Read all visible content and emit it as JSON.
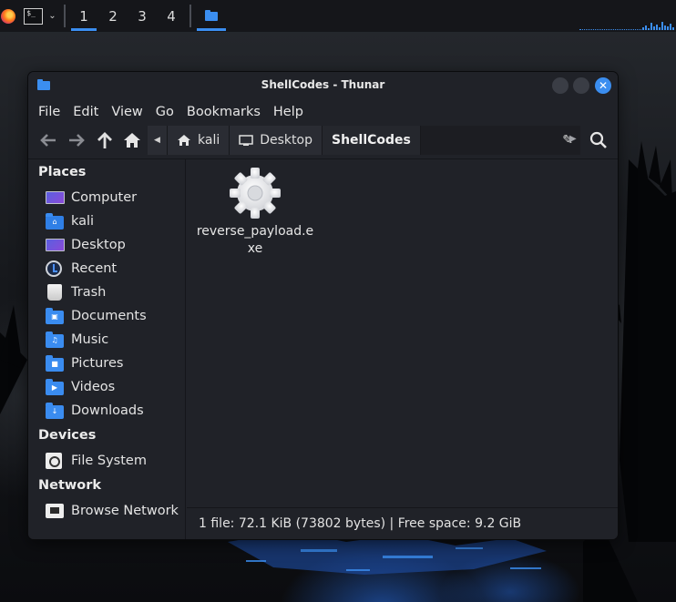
{
  "panel": {
    "launchers": [
      {
        "icon": "firefox-icon"
      },
      {
        "icon": "terminal-icon",
        "glyph": "$_"
      }
    ],
    "workspaces": [
      "1",
      "2",
      "3",
      "4"
    ],
    "active_workspace": "1",
    "tasks": [
      {
        "icon": "folder-icon",
        "title": "ShellCodes - Thunar"
      }
    ],
    "accent": "#3b8ef0"
  },
  "window": {
    "title": "ShellCodes - Thunar",
    "controls": {
      "close_glyph": "✕"
    }
  },
  "menubar": {
    "items": [
      "File",
      "Edit",
      "View",
      "Go",
      "Bookmarks",
      "Help"
    ]
  },
  "toolbar": {
    "back_icon": "arrow-left-icon",
    "forward_icon": "arrow-right-icon",
    "up_icon": "arrow-up-icon",
    "home_icon": "home-icon",
    "search_icon": "search-icon"
  },
  "pathbar": {
    "crumbs": [
      "kali",
      "Desktop",
      "ShellCodes"
    ],
    "current": "ShellCodes"
  },
  "sidebar": {
    "places_heading": "Places",
    "places": [
      {
        "label": "Computer",
        "icon": "computer-icon"
      },
      {
        "label": "kali",
        "icon": "home-folder-icon"
      },
      {
        "label": "Desktop",
        "icon": "desktop-icon"
      },
      {
        "label": "Recent",
        "icon": "recent-icon"
      },
      {
        "label": "Trash",
        "icon": "trash-icon"
      },
      {
        "label": "Documents",
        "icon": "documents-folder-icon"
      },
      {
        "label": "Music",
        "icon": "music-folder-icon"
      },
      {
        "label": "Pictures",
        "icon": "pictures-folder-icon"
      },
      {
        "label": "Videos",
        "icon": "videos-folder-icon"
      },
      {
        "label": "Downloads",
        "icon": "downloads-folder-icon"
      }
    ],
    "devices_heading": "Devices",
    "devices": [
      {
        "label": "File System",
        "icon": "drive-icon"
      }
    ],
    "network_heading": "Network",
    "network": [
      {
        "label": "Browse Network",
        "icon": "network-icon"
      }
    ]
  },
  "files": [
    {
      "name": "reverse_payload.exe",
      "icon": "executable-gear-icon"
    }
  ],
  "status": {
    "text": "1 file: 72.1 KiB (73802 bytes)  |  Free space: 9.2 GiB"
  }
}
